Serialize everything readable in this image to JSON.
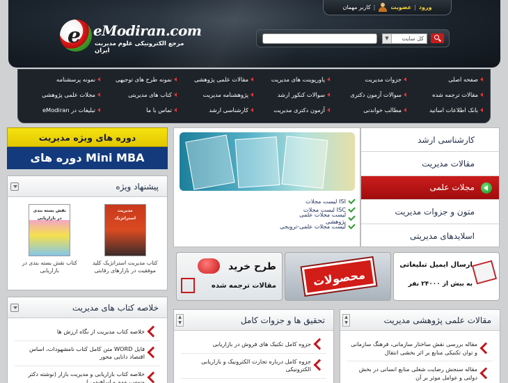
{
  "header": {
    "login": "ورود",
    "register": "عضویت",
    "sep": "|",
    "guest": "کاربر مهمان",
    "brand": "eModiran.com",
    "tagline": "مرجع الکترونیکی علوم مدیریت ایران",
    "search_scope": "کل سایت",
    "search_placeholder": ""
  },
  "nav": {
    "items": [
      "صفحه اصلی",
      "جزوات مدیریت",
      "پاورپوینت های مدیریت",
      "مقالات علمی پژوهشی",
      "نمونه طرح های توجیهی",
      "نمونه پرسشنامه",
      "مقالات ترجمه شده",
      "سوالات آزمون دکتری",
      "سوالات کنکور ارشد",
      "پژوهشنامه مدیریت",
      "کتاب های مدیریتی",
      "مجلات علمی پژوهشی",
      "بانک اطلاعات اساتید",
      "مطالب خواندنی",
      "آزمون دکتری مدیریت",
      "کارشناسی ارشد",
      "تماس با ما",
      "تبلیغات در eModiran"
    ]
  },
  "ad": {
    "line1": "دوره های ویژه مدیریت",
    "line2": "دوره های Mini MBA"
  },
  "suggestion": {
    "title": "پیشنهاد ویژه",
    "books": [
      {
        "title": "کتاب مدیریت استراتژیک کلید موفقیت در بازارهای رقابتی",
        "cover": "مدیریت استراتژیک"
      },
      {
        "title": "کتاب نقش بسته بندی در بازاریابی",
        "cover": "نقش بسته بندی در بازاریابی"
      }
    ]
  },
  "summaries": {
    "title": "خلاصه کتاب های مدیریت",
    "items": [
      "خلاصه کتاب مدیریت از نگاه ارزش ها",
      "فایل WORD متن کامل کتاب نامشهودات، اساس اقتصاد دانایی محور",
      "خلاصه کتاب بازاریابی و مدیریت بازار (نوشته دکتر ونوس، مهم و ابراهیمی )"
    ]
  },
  "categories": {
    "items": [
      {
        "label": "کارشناسی ارشد",
        "active": false
      },
      {
        "label": "مقالات مدیریت",
        "active": false
      },
      {
        "label": "مجلات علمی",
        "active": true
      },
      {
        "label": "متون و جزوات مدیریت",
        "active": false
      },
      {
        "label": "اسلایدهای مدیریتی",
        "active": false
      }
    ]
  },
  "journals": {
    "items": [
      "لیست مجلات ISI",
      "لیست مجلات ISC",
      "لیست مجلات علمی پژوهشی",
      "لیست مجلات علمی-ترویجی"
    ]
  },
  "banners": {
    "email_line1": "ارسال ایمیل تبلیغاتی",
    "email_line2": "به بیش از ۲۴۰۰۰ نفر",
    "products": "محصولات",
    "translate_line1": "طرح خرید",
    "translate_line2": "مقالات ترجمه شده"
  },
  "research": {
    "title": "تحقیق ها و جزوات کامل",
    "items": [
      "جزوه کامل تکنیک های فروش در بازاریابی",
      "جزوه کامل درباره تجارت الکترونیک و بازاریابی الکترونیکی"
    ]
  },
  "articles": {
    "title": "مقالات علمی پژوهشی مدیریت",
    "items": [
      "مقاله بررسی نقش ساختار سازمانی، فرهنگ سازمانی و توان تکنیکی منابع بر اثر بخشی انتقال",
      "مقاله سنجش رضایت شغلی منابع انسانی در بخش دولتی و عوامل موثر بر آن"
    ]
  }
}
